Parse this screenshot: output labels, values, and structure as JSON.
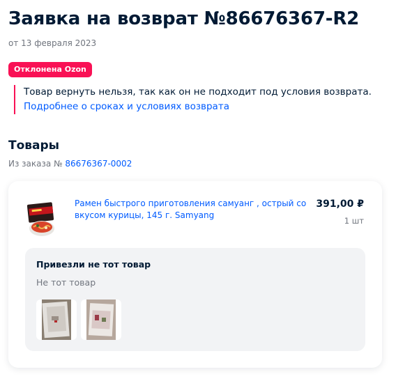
{
  "header": {
    "title": "Заявка на возврат №86676367-R2",
    "date": "от 13 февраля 2023"
  },
  "status": {
    "badge": "Отклонена Ozon",
    "color": "#f91155",
    "notice": "Товар вернуть нельзя, так как он не подходит под условия возврата.",
    "link": "Подробнее о сроках и условиях возврата"
  },
  "goods": {
    "title": "Товары",
    "order_prefix": "Из заказа №",
    "order_number": "86676367-0002"
  },
  "product": {
    "icon": "ramen-package-icon",
    "name": "Рамен быстрого приготовления самуанг , острый со вкусом курицы, 145 г. Samyang",
    "price": "391,00 ₽",
    "quantity": "1 шт"
  },
  "reason": {
    "title": "Привезли не тот товар",
    "comment": "Не тот товар",
    "photos": [
      "photo-icon",
      "photo-icon"
    ]
  },
  "colors": {
    "accent": "#005bff",
    "text": "#001a34",
    "muted": "#70757e",
    "reject": "#f91155"
  }
}
